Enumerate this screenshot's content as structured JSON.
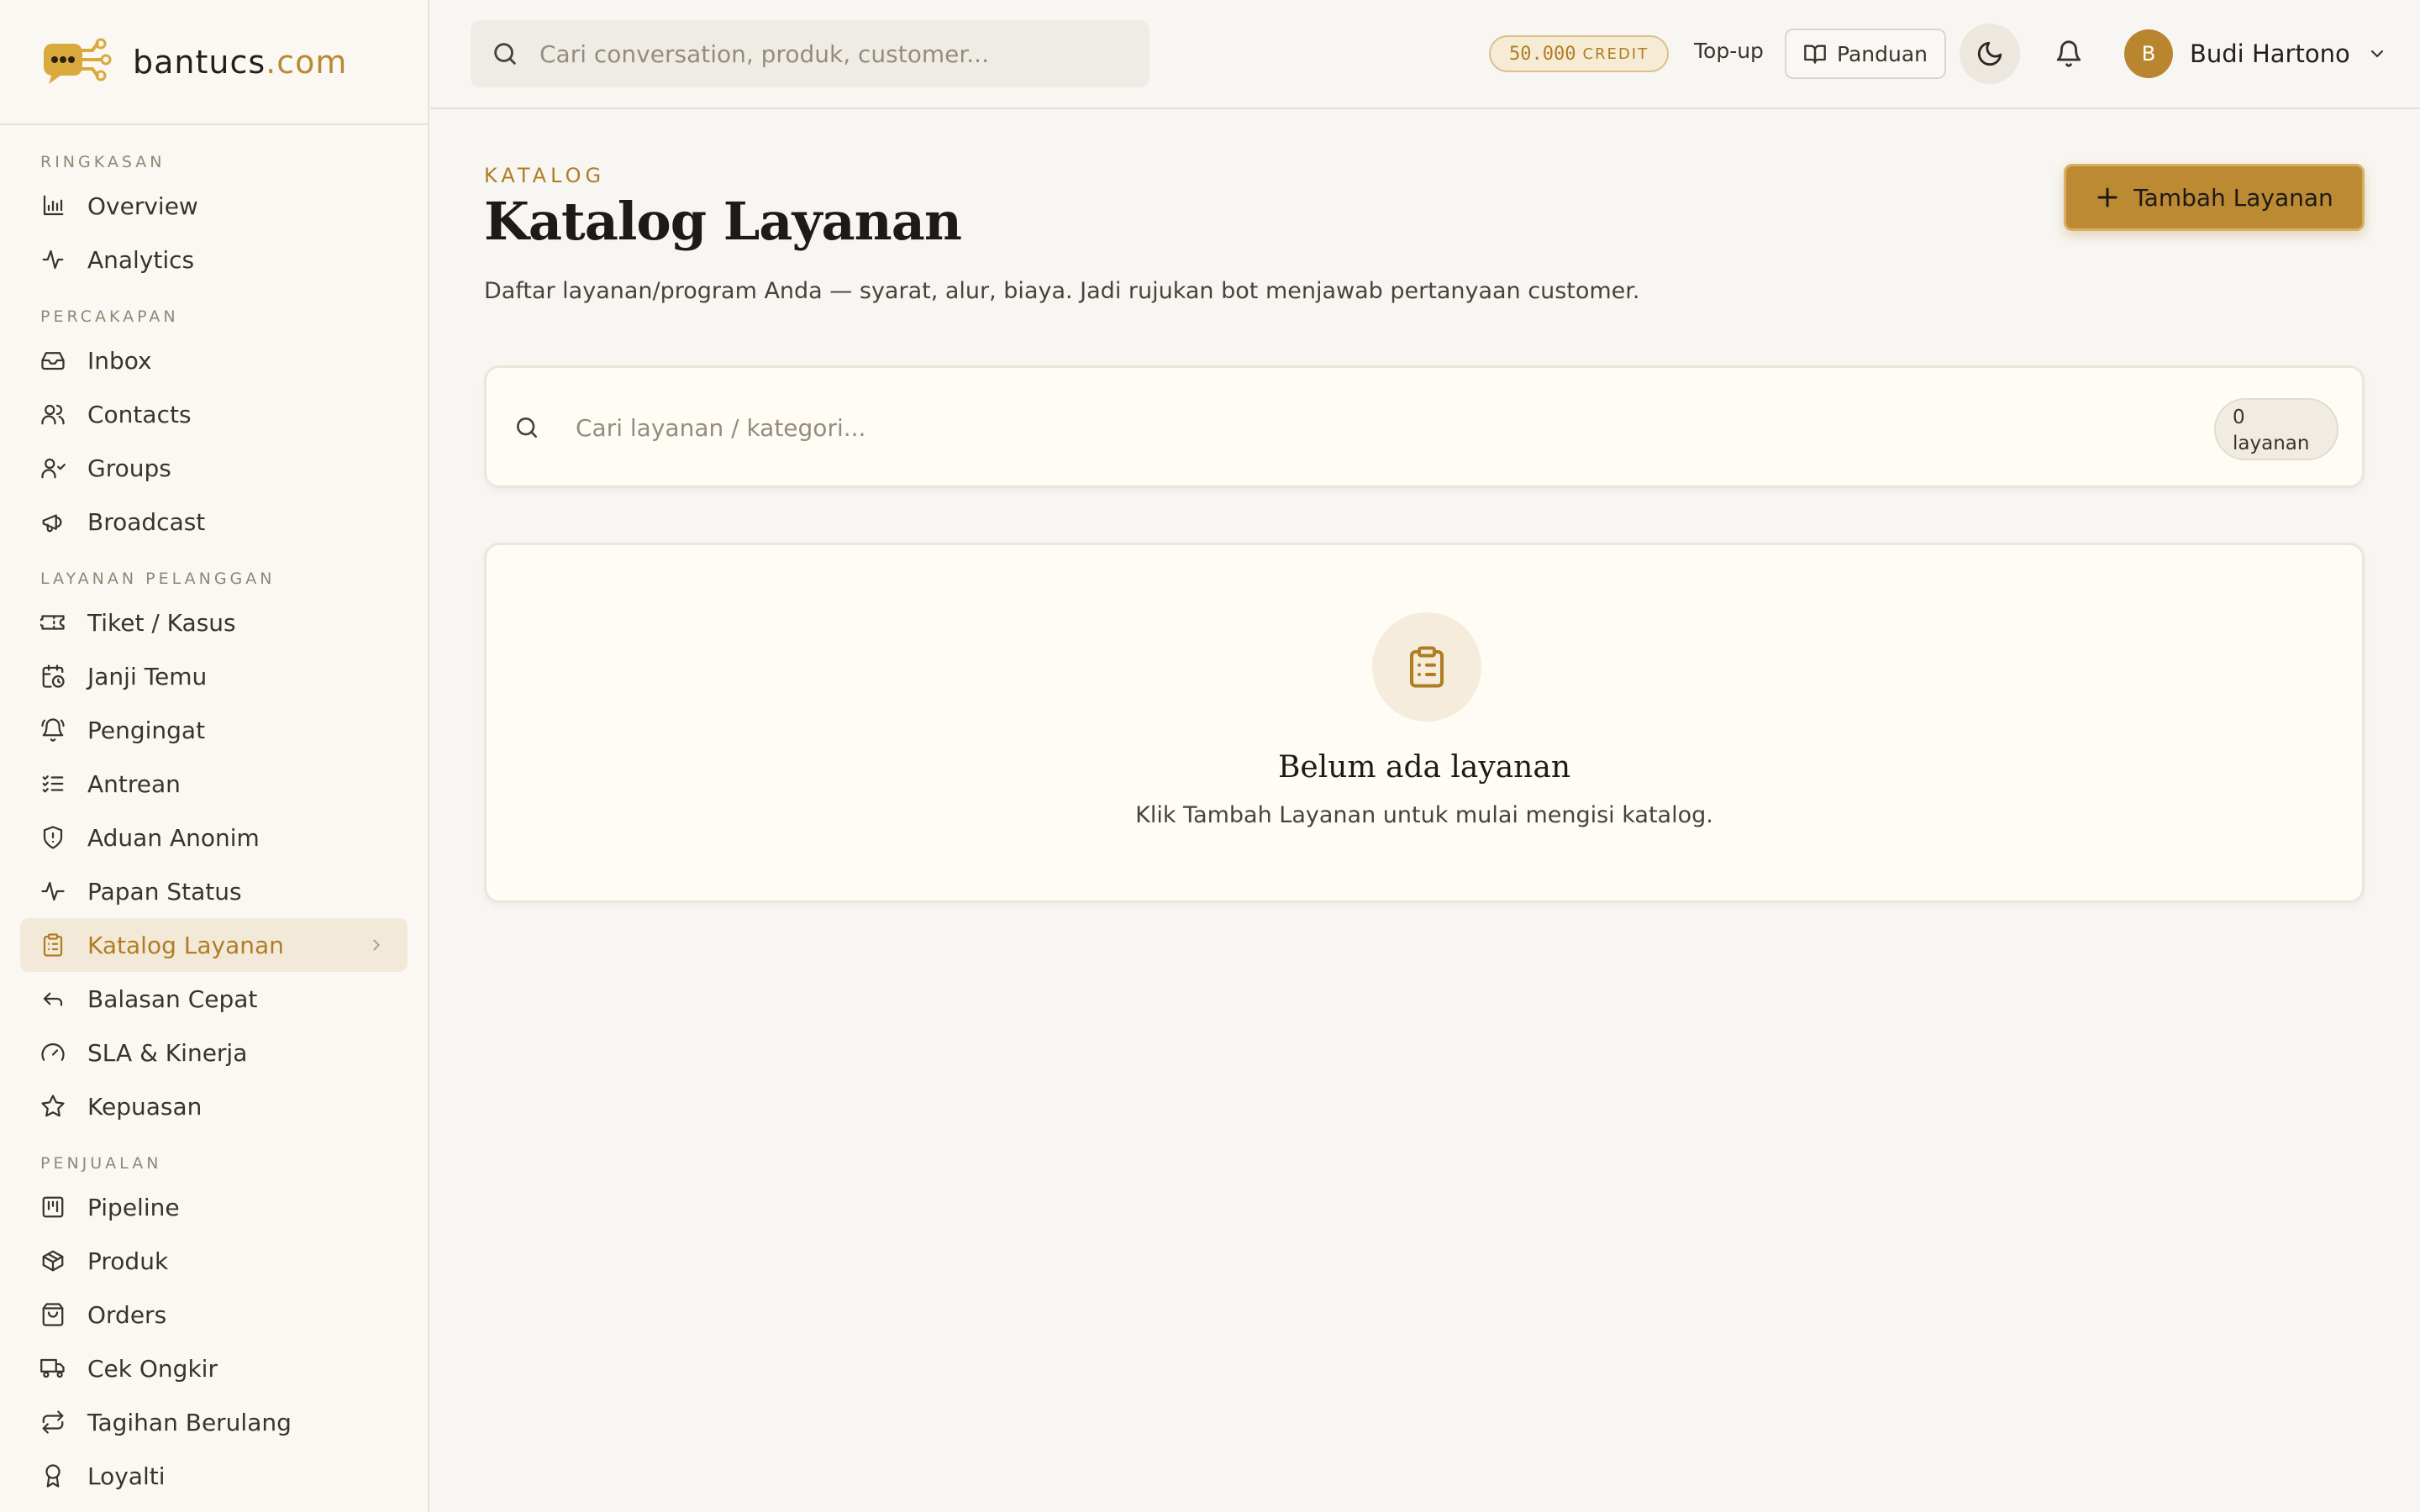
{
  "brand": {
    "name": "bantucs",
    "tld": ".com"
  },
  "sidebar": {
    "sections": [
      {
        "title": "RINGKASAN",
        "items": [
          {
            "label": "Overview",
            "icon": "bar-chart-icon"
          },
          {
            "label": "Analytics",
            "icon": "activity-icon"
          }
        ]
      },
      {
        "title": "PERCAKAPAN",
        "items": [
          {
            "label": "Inbox",
            "icon": "inbox-icon"
          },
          {
            "label": "Contacts",
            "icon": "users-icon"
          },
          {
            "label": "Groups",
            "icon": "group-icon"
          },
          {
            "label": "Broadcast",
            "icon": "megaphone-icon"
          }
        ]
      },
      {
        "title": "LAYANAN PELANGGAN",
        "items": [
          {
            "label": "Tiket / Kasus",
            "icon": "ticket-icon"
          },
          {
            "label": "Janji Temu",
            "icon": "calendar-clock-icon"
          },
          {
            "label": "Pengingat",
            "icon": "bell-ring-icon"
          },
          {
            "label": "Antrean",
            "icon": "list-checks-icon"
          },
          {
            "label": "Aduan Anonim",
            "icon": "shield-icon"
          },
          {
            "label": "Papan Status",
            "icon": "pulse-icon"
          },
          {
            "label": "Katalog Layanan",
            "icon": "clipboard-list-icon",
            "active": true
          },
          {
            "label": "Balasan Cepat",
            "icon": "reply-icon"
          },
          {
            "label": "SLA & Kinerja",
            "icon": "gauge-icon"
          },
          {
            "label": "Kepuasan",
            "icon": "star-icon"
          }
        ]
      },
      {
        "title": "PENJUALAN",
        "items": [
          {
            "label": "Pipeline",
            "icon": "kanban-icon"
          },
          {
            "label": "Produk",
            "icon": "package-icon"
          },
          {
            "label": "Orders",
            "icon": "shopping-bag-icon"
          },
          {
            "label": "Cek Ongkir",
            "icon": "truck-icon"
          },
          {
            "label": "Tagihan Berulang",
            "icon": "repeat-icon"
          },
          {
            "label": "Loyalti",
            "icon": "award-icon"
          }
        ]
      }
    ]
  },
  "topbar": {
    "search_placeholder": "Cari conversation, produk, customer...",
    "credit_amount": "50.000",
    "credit_unit": "CREDIT",
    "topup_label": "Top-up",
    "guide_label": "Panduan",
    "user_initial": "B",
    "user_name": "Budi Hartono"
  },
  "page": {
    "eyebrow": "KATALOG",
    "title": "Katalog Layanan",
    "description": "Daftar layanan/program Anda — syarat, alur, biaya. Jadi rujukan bot menjawab pertanyaan customer.",
    "add_button_label": "Tambah Layanan",
    "search_placeholder": "Cari layanan / kategori...",
    "count_number": "0",
    "count_unit": "layanan",
    "empty_title": "Belum ada layanan",
    "empty_description": "Klik Tambah Layanan untuk mulai mengisi katalog."
  },
  "colors": {
    "accent": "#b07d22",
    "button": "#bc8a33",
    "active_bg": "#f3e9d9"
  }
}
